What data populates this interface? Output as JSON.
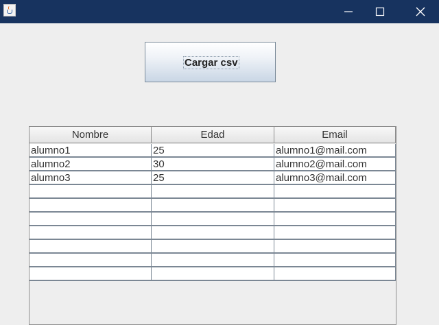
{
  "window": {
    "app_icon": "java-icon",
    "controls": [
      "minimize-icon",
      "maximize-icon",
      "close-icon"
    ]
  },
  "toolbar": {
    "load_csv_label": "Cargar csv"
  },
  "table": {
    "columns": [
      "Nombre",
      "Edad",
      "Email"
    ],
    "rows": [
      [
        "alumno1",
        "25",
        "alumno1@mail.com"
      ],
      [
        "alumno2",
        "30",
        "alumno2@mail.com"
      ],
      [
        "alumno3",
        "25",
        "alumno3@mail.com"
      ],
      [
        "",
        "",
        ""
      ],
      [
        "",
        "",
        ""
      ],
      [
        "",
        "",
        ""
      ],
      [
        "",
        "",
        ""
      ],
      [
        "",
        "",
        ""
      ],
      [
        "",
        "",
        ""
      ],
      [
        "",
        "",
        ""
      ]
    ]
  }
}
